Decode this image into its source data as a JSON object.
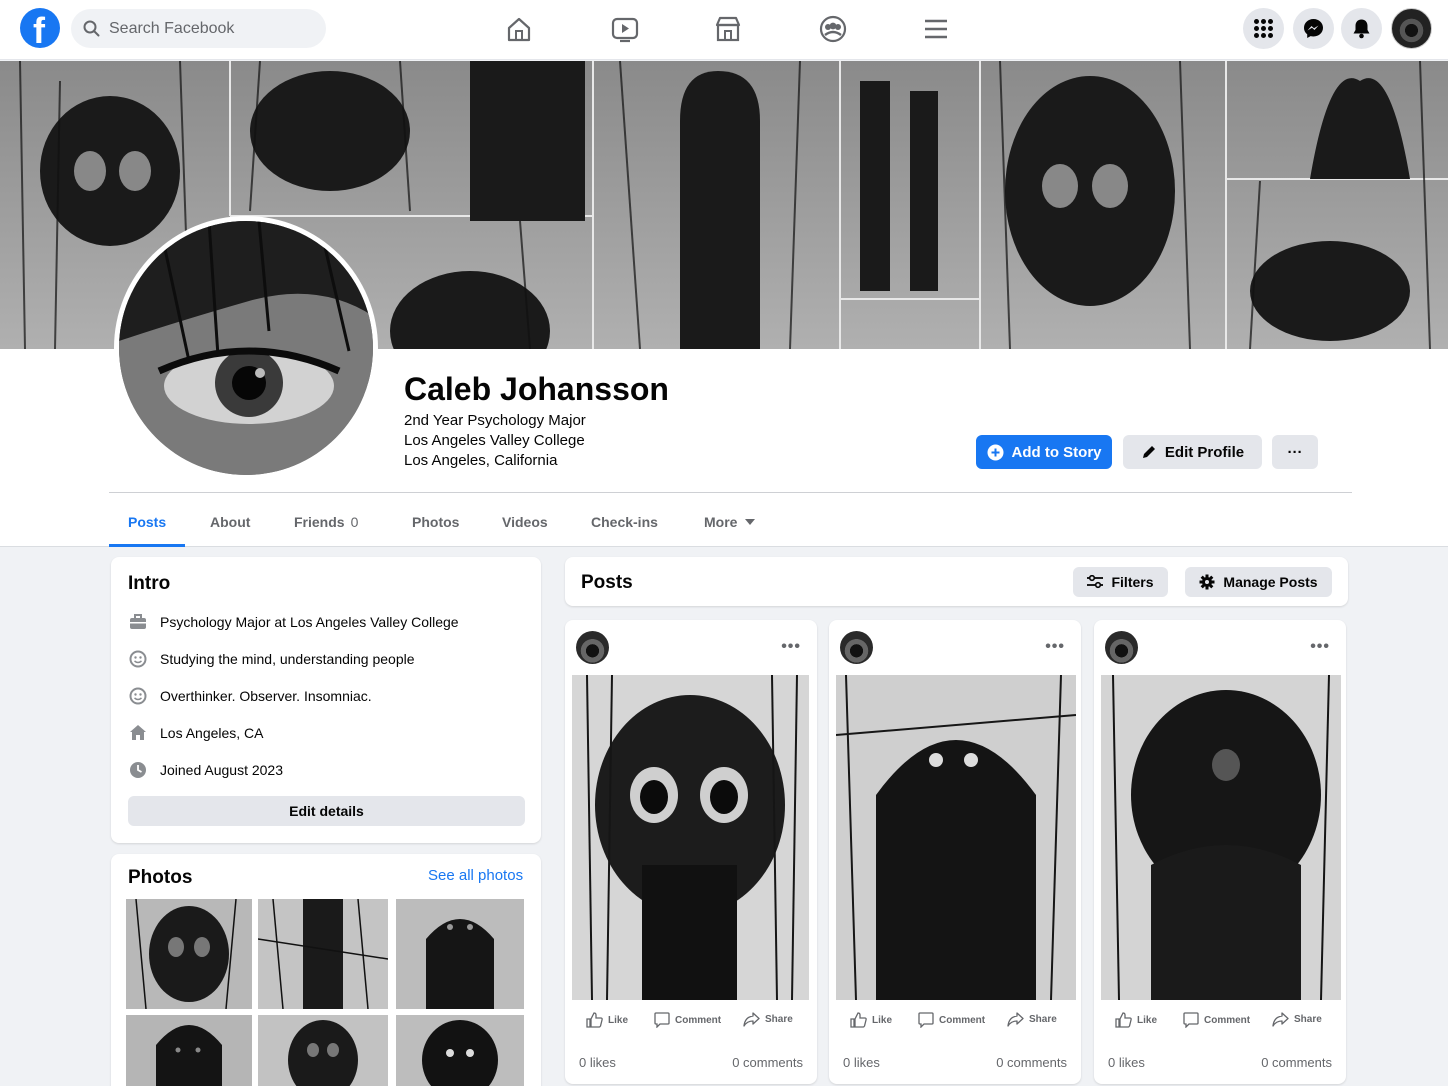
{
  "nav": {
    "search_placeholder": "Search Facebook",
    "accent": "#1877f2"
  },
  "profile": {
    "name": "Caleb Johansson",
    "bio_lines": [
      "2nd Year Psychology Major",
      "Los Angeles Valley College",
      "Los Angeles, California"
    ],
    "add_story_label": "Add to Story",
    "edit_profile_label": "Edit Profile",
    "more_label": "···"
  },
  "tabs": [
    {
      "label": "Posts",
      "active": true
    },
    {
      "label": "About"
    },
    {
      "label": "Friends",
      "count": "0"
    },
    {
      "label": "Photos"
    },
    {
      "label": "Videos"
    },
    {
      "label": "Check-ins"
    },
    {
      "label": "More"
    }
  ],
  "intro": {
    "title": "Intro",
    "items": [
      {
        "icon": "briefcase-icon",
        "text": "Psychology Major at Los Angeles Valley College"
      },
      {
        "icon": "smiley-icon",
        "text": "Studying the mind, understanding people"
      },
      {
        "icon": "smiley-icon",
        "text": "Overthinker. Observer. Insomniac."
      },
      {
        "icon": "home-icon",
        "text": "Los Angeles, CA"
      },
      {
        "icon": "clock-icon",
        "text": "Joined August 2023"
      }
    ],
    "edit_details_label": "Edit details"
  },
  "photos_card": {
    "title": "Photos",
    "see_all_label": "See all photos"
  },
  "posts_header": {
    "title": "Posts",
    "filters_label": "Filters",
    "manage_label": "Manage Posts"
  },
  "posts": [
    {
      "like_label": "Like",
      "comment_label": "Comment",
      "share_label": "Share",
      "likes": "0 likes",
      "comments": "0 comments"
    },
    {
      "like_label": "Like",
      "comment_label": "Comment",
      "share_label": "Share",
      "likes": "0 likes",
      "comments": "0 comments"
    },
    {
      "like_label": "Like",
      "comment_label": "Comment",
      "share_label": "Share",
      "likes": "0 likes",
      "comments": "0 comments"
    }
  ]
}
